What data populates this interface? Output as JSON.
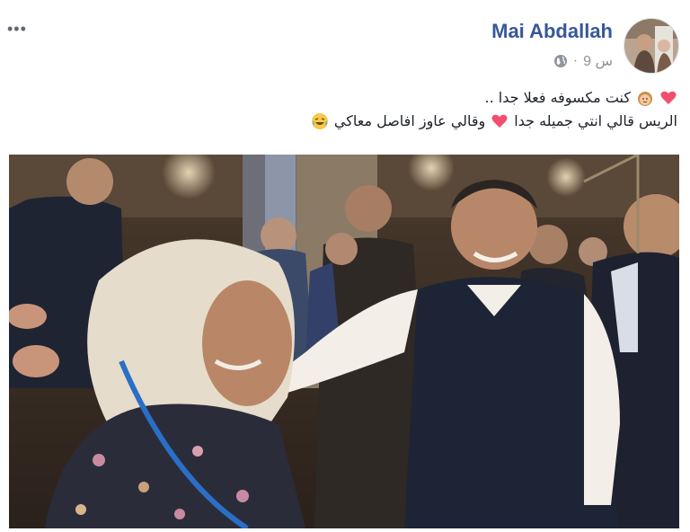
{
  "post": {
    "author": "Mai Abdallah",
    "timestamp": "9 س",
    "separator": "·",
    "privacy_icon": "globe-icon",
    "more_icon": "more-options-icon",
    "more_label": "•••",
    "text_line_1": "كنت مكسوفه فعلا جدا ..",
    "text_line_2a": "الريس قالي انتي جميله جدا",
    "text_line_2b": "وقالي عاوز افاصل معاكي",
    "emojis": [
      "heart-icon",
      "girl-face-icon",
      "heart-icon",
      "laughing-face-icon"
    ],
    "image_icon": "photo-image"
  },
  "colors": {
    "author": "#365899",
    "meta": "#90949c",
    "text": "#1d2129",
    "heart": "#f0506e"
  }
}
